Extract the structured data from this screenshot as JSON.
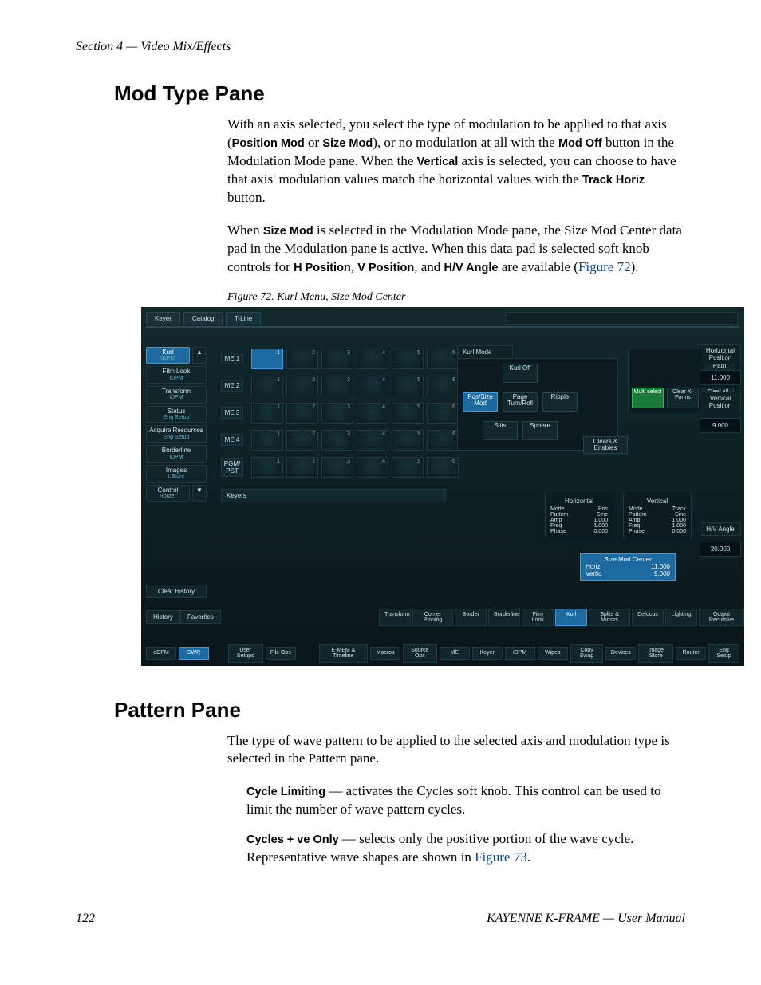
{
  "header": {
    "running_head": "Section 4 — Video Mix/Effects"
  },
  "sections": {
    "mod_type_title": "Mod Type Pane",
    "pattern_title": "Pattern Pane"
  },
  "para": {
    "p1_a": "With an axis selected, you select the type of modulation to be applied to that axis (",
    "p1_b1": "Position Mod",
    "p1_c": " or ",
    "p1_b2": "Size Mod",
    "p1_d": "), or no modulation at all with the ",
    "p1_b3": "Mod Off",
    "p1_e": " button in the Modulation Mode pane. When the ",
    "p1_b4": "Vertical",
    "p1_f": " axis is selected, you can choose to have that axis' modulation values match the horizontal values with the ",
    "p1_b5": "Track  Horiz",
    "p1_g": " button.",
    "p2_a": "When ",
    "p2_b1": "Size Mod",
    "p2_b": " is selected in the Modulation Mode pane, the Size Mod Center data pad in the Modulation pane is active. When this data pad is selected soft knob controls for ",
    "p2_b2": "H Position",
    "p2_c": ", ",
    "p2_b3": "V Position",
    "p2_d": ", and ",
    "p2_b4": "H/V Angle",
    "p2_e": " are available (",
    "p2_link": "Figure 72",
    "p2_f": ").",
    "p3": "The type of wave pattern to be applied to the selected axis and modulation type is selected in the Pattern pane.",
    "p4_b": "Cycle Limiting",
    "p4_a": " — activates the Cycles soft knob. This control can be used to limit the number of wave pattern cycles.",
    "p5_b": "Cycles + ve Only",
    "p5_a": " — selects only the positive portion of the wave cycle. Representative wave shapes are shown in ",
    "p5_link": "Figure 73",
    "p5_c": "."
  },
  "figure": {
    "caption": "Figure 72.  Kurl Menu, Size Mod Center"
  },
  "ui": {
    "top_tabs": [
      "Keyer",
      "Catalog"
    ],
    "tline": "T-Line",
    "nav": [
      {
        "t": "Kurl",
        "s": "iDPM",
        "sel": true
      },
      {
        "t": "Film Look",
        "s": "iDPM"
      },
      {
        "t": "Transform",
        "s": "iDPM"
      },
      {
        "t": "Status",
        "s": "Eng Setup"
      },
      {
        "t": "Acquire Resources",
        "s": "Eng Setup"
      },
      {
        "t": "Borderline",
        "s": "iDPM"
      },
      {
        "t": "Images",
        "s": "I.Store"
      },
      {
        "t": "Control",
        "s": "Router"
      }
    ],
    "clear_history": "Clear History",
    "history": "History",
    "favorites": "Favorites",
    "me_labels": [
      "ME 1",
      "ME 2",
      "ME 3",
      "ME 4",
      "PGM/\nPST"
    ],
    "keyers": "Keyers",
    "kurl_mode_label": "Kurl Mode",
    "mode": {
      "off": "Kurl Off",
      "possize": "Pos/Size Mod",
      "page": "Page Turn/Roll",
      "ripple": "Ripple",
      "slits": "Slits",
      "sphere": "Sphere"
    },
    "adjust_path": "Adjust Path",
    "xforms": {
      "multi": "Multi select",
      "clearx": "Clear X-Forms",
      "clearall": "Clear All"
    },
    "clears_enables": "Clears & Enables",
    "knobs": [
      {
        "label": "Horizontal Position",
        "val": "11.000"
      },
      {
        "label": "Vertical Position",
        "val": "9.000"
      },
      {
        "label": "H/V Angle",
        "val": "20.000"
      }
    ],
    "hv": {
      "horiz_title": "Horizontal",
      "vert_title": "Vertical",
      "rows_h": [
        [
          "Mode",
          "Pos"
        ],
        [
          "Pattern",
          "Sine"
        ],
        [
          "Amp",
          "1.000"
        ],
        [
          "Freq",
          "1.000"
        ],
        [
          "Phase",
          "0.000"
        ]
      ],
      "rows_v": [
        [
          "Mode",
          "Track"
        ],
        [
          "Pattern",
          "Sine"
        ],
        [
          "Amp",
          "1.000"
        ],
        [
          "Freq",
          "1.000"
        ],
        [
          "Phase",
          "0.000"
        ]
      ]
    },
    "size_mod": {
      "title": "Size Mod Center",
      "horiz_l": "Horiz",
      "horiz_v": "11.000",
      "vert_l": "Vertic",
      "vert_v": "9.000"
    },
    "bottom_effect_tabs": [
      "Transform",
      "Corner Pinning",
      "Border",
      "Borderline",
      "Film Look",
      "Kurl",
      "Splits & Mirrors",
      "Defocus",
      "Lighting",
      "Output Recursive"
    ],
    "bottom_effect_sel": 5,
    "footbar_left": [
      "eDPM",
      "SWR"
    ],
    "footbar_left_sel": 1,
    "footbar": [
      "User Setups",
      "File Ops",
      "",
      "E-MEM & Timeline",
      "Macros",
      "Source Ops",
      "ME",
      "Keyer",
      "iDPM",
      "Wipes",
      "Copy Swap",
      "Devices",
      "Image Store",
      "Router",
      "Eng Setup"
    ]
  },
  "footer": {
    "page": "122",
    "manual": "KAYENNE K-FRAME — User Manual"
  }
}
